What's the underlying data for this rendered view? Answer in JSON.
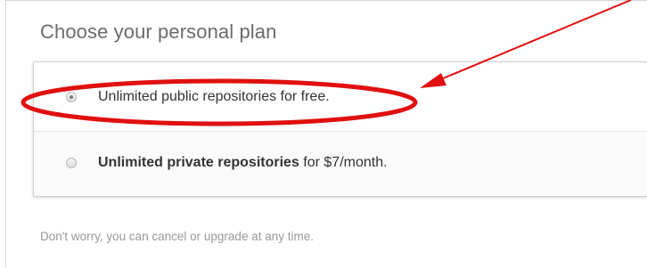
{
  "header": {
    "title": "Choose your personal plan"
  },
  "plans": [
    {
      "label": "Unlimited public repositories for free.",
      "selected": true
    },
    {
      "label_strong": "Unlimited private repositories",
      "label_rest": " for $7/month.",
      "selected": false
    }
  ],
  "footer_note": "Don't worry, you can cancel or upgrade at any time.",
  "colors": {
    "annotation": "#e01010",
    "title": "#6b6b6b",
    "body_text": "#333333",
    "muted_text": "#999999"
  },
  "icons": {
    "selected_radio": "radio-selected-icon",
    "unselected_radio": "radio-unselected-icon",
    "annotation_arrow": "arrow-icon"
  }
}
